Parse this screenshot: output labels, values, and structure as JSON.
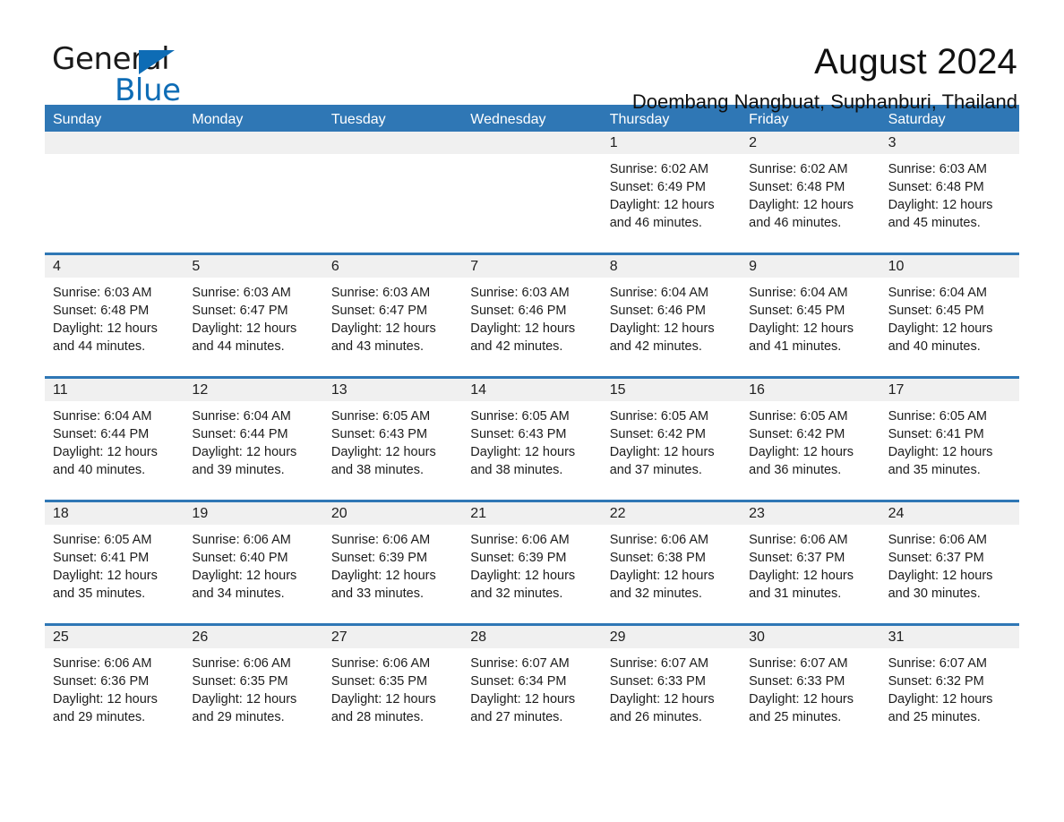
{
  "brand": {
    "name_part1": "General",
    "name_part2": "Blue",
    "accent_color": "#0e6cb5"
  },
  "header": {
    "month_title": "August 2024",
    "location": "Doembang Nangbuat, Suphanburi, Thailand",
    "header_bg_color": "#2f77b5",
    "daynum_band_color": "#f0f0f0"
  },
  "weekdays": [
    "Sunday",
    "Monday",
    "Tuesday",
    "Wednesday",
    "Thursday",
    "Friday",
    "Saturday"
  ],
  "weeks": [
    [
      {
        "day": "",
        "sunrise": "",
        "sunset": "",
        "daylight_line1": "",
        "daylight_line2": "",
        "empty": true
      },
      {
        "day": "",
        "sunrise": "",
        "sunset": "",
        "daylight_line1": "",
        "daylight_line2": "",
        "empty": true
      },
      {
        "day": "",
        "sunrise": "",
        "sunset": "",
        "daylight_line1": "",
        "daylight_line2": "",
        "empty": true
      },
      {
        "day": "",
        "sunrise": "",
        "sunset": "",
        "daylight_line1": "",
        "daylight_line2": "",
        "empty": true
      },
      {
        "day": "1",
        "sunrise": "Sunrise: 6:02 AM",
        "sunset": "Sunset: 6:49 PM",
        "daylight_line1": "Daylight: 12 hours",
        "daylight_line2": "and 46 minutes."
      },
      {
        "day": "2",
        "sunrise": "Sunrise: 6:02 AM",
        "sunset": "Sunset: 6:48 PM",
        "daylight_line1": "Daylight: 12 hours",
        "daylight_line2": "and 46 minutes."
      },
      {
        "day": "3",
        "sunrise": "Sunrise: 6:03 AM",
        "sunset": "Sunset: 6:48 PM",
        "daylight_line1": "Daylight: 12 hours",
        "daylight_line2": "and 45 minutes."
      }
    ],
    [
      {
        "day": "4",
        "sunrise": "Sunrise: 6:03 AM",
        "sunset": "Sunset: 6:48 PM",
        "daylight_line1": "Daylight: 12 hours",
        "daylight_line2": "and 44 minutes."
      },
      {
        "day": "5",
        "sunrise": "Sunrise: 6:03 AM",
        "sunset": "Sunset: 6:47 PM",
        "daylight_line1": "Daylight: 12 hours",
        "daylight_line2": "and 44 minutes."
      },
      {
        "day": "6",
        "sunrise": "Sunrise: 6:03 AM",
        "sunset": "Sunset: 6:47 PM",
        "daylight_line1": "Daylight: 12 hours",
        "daylight_line2": "and 43 minutes."
      },
      {
        "day": "7",
        "sunrise": "Sunrise: 6:03 AM",
        "sunset": "Sunset: 6:46 PM",
        "daylight_line1": "Daylight: 12 hours",
        "daylight_line2": "and 42 minutes."
      },
      {
        "day": "8",
        "sunrise": "Sunrise: 6:04 AM",
        "sunset": "Sunset: 6:46 PM",
        "daylight_line1": "Daylight: 12 hours",
        "daylight_line2": "and 42 minutes."
      },
      {
        "day": "9",
        "sunrise": "Sunrise: 6:04 AM",
        "sunset": "Sunset: 6:45 PM",
        "daylight_line1": "Daylight: 12 hours",
        "daylight_line2": "and 41 minutes."
      },
      {
        "day": "10",
        "sunrise": "Sunrise: 6:04 AM",
        "sunset": "Sunset: 6:45 PM",
        "daylight_line1": "Daylight: 12 hours",
        "daylight_line2": "and 40 minutes."
      }
    ],
    [
      {
        "day": "11",
        "sunrise": "Sunrise: 6:04 AM",
        "sunset": "Sunset: 6:44 PM",
        "daylight_line1": "Daylight: 12 hours",
        "daylight_line2": "and 40 minutes."
      },
      {
        "day": "12",
        "sunrise": "Sunrise: 6:04 AM",
        "sunset": "Sunset: 6:44 PM",
        "daylight_line1": "Daylight: 12 hours",
        "daylight_line2": "and 39 minutes."
      },
      {
        "day": "13",
        "sunrise": "Sunrise: 6:05 AM",
        "sunset": "Sunset: 6:43 PM",
        "daylight_line1": "Daylight: 12 hours",
        "daylight_line2": "and 38 minutes."
      },
      {
        "day": "14",
        "sunrise": "Sunrise: 6:05 AM",
        "sunset": "Sunset: 6:43 PM",
        "daylight_line1": "Daylight: 12 hours",
        "daylight_line2": "and 38 minutes."
      },
      {
        "day": "15",
        "sunrise": "Sunrise: 6:05 AM",
        "sunset": "Sunset: 6:42 PM",
        "daylight_line1": "Daylight: 12 hours",
        "daylight_line2": "and 37 minutes."
      },
      {
        "day": "16",
        "sunrise": "Sunrise: 6:05 AM",
        "sunset": "Sunset: 6:42 PM",
        "daylight_line1": "Daylight: 12 hours",
        "daylight_line2": "and 36 minutes."
      },
      {
        "day": "17",
        "sunrise": "Sunrise: 6:05 AM",
        "sunset": "Sunset: 6:41 PM",
        "daylight_line1": "Daylight: 12 hours",
        "daylight_line2": "and 35 minutes."
      }
    ],
    [
      {
        "day": "18",
        "sunrise": "Sunrise: 6:05 AM",
        "sunset": "Sunset: 6:41 PM",
        "daylight_line1": "Daylight: 12 hours",
        "daylight_line2": "and 35 minutes."
      },
      {
        "day": "19",
        "sunrise": "Sunrise: 6:06 AM",
        "sunset": "Sunset: 6:40 PM",
        "daylight_line1": "Daylight: 12 hours",
        "daylight_line2": "and 34 minutes."
      },
      {
        "day": "20",
        "sunrise": "Sunrise: 6:06 AM",
        "sunset": "Sunset: 6:39 PM",
        "daylight_line1": "Daylight: 12 hours",
        "daylight_line2": "and 33 minutes."
      },
      {
        "day": "21",
        "sunrise": "Sunrise: 6:06 AM",
        "sunset": "Sunset: 6:39 PM",
        "daylight_line1": "Daylight: 12 hours",
        "daylight_line2": "and 32 minutes."
      },
      {
        "day": "22",
        "sunrise": "Sunrise: 6:06 AM",
        "sunset": "Sunset: 6:38 PM",
        "daylight_line1": "Daylight: 12 hours",
        "daylight_line2": "and 32 minutes."
      },
      {
        "day": "23",
        "sunrise": "Sunrise: 6:06 AM",
        "sunset": "Sunset: 6:37 PM",
        "daylight_line1": "Daylight: 12 hours",
        "daylight_line2": "and 31 minutes."
      },
      {
        "day": "24",
        "sunrise": "Sunrise: 6:06 AM",
        "sunset": "Sunset: 6:37 PM",
        "daylight_line1": "Daylight: 12 hours",
        "daylight_line2": "and 30 minutes."
      }
    ],
    [
      {
        "day": "25",
        "sunrise": "Sunrise: 6:06 AM",
        "sunset": "Sunset: 6:36 PM",
        "daylight_line1": "Daylight: 12 hours",
        "daylight_line2": "and 29 minutes."
      },
      {
        "day": "26",
        "sunrise": "Sunrise: 6:06 AM",
        "sunset": "Sunset: 6:35 PM",
        "daylight_line1": "Daylight: 12 hours",
        "daylight_line2": "and 29 minutes."
      },
      {
        "day": "27",
        "sunrise": "Sunrise: 6:06 AM",
        "sunset": "Sunset: 6:35 PM",
        "daylight_line1": "Daylight: 12 hours",
        "daylight_line2": "and 28 minutes."
      },
      {
        "day": "28",
        "sunrise": "Sunrise: 6:07 AM",
        "sunset": "Sunset: 6:34 PM",
        "daylight_line1": "Daylight: 12 hours",
        "daylight_line2": "and 27 minutes."
      },
      {
        "day": "29",
        "sunrise": "Sunrise: 6:07 AM",
        "sunset": "Sunset: 6:33 PM",
        "daylight_line1": "Daylight: 12 hours",
        "daylight_line2": "and 26 minutes."
      },
      {
        "day": "30",
        "sunrise": "Sunrise: 6:07 AM",
        "sunset": "Sunset: 6:33 PM",
        "daylight_line1": "Daylight: 12 hours",
        "daylight_line2": "and 25 minutes."
      },
      {
        "day": "31",
        "sunrise": "Sunrise: 6:07 AM",
        "sunset": "Sunset: 6:32 PM",
        "daylight_line1": "Daylight: 12 hours",
        "daylight_line2": "and 25 minutes."
      }
    ]
  ]
}
